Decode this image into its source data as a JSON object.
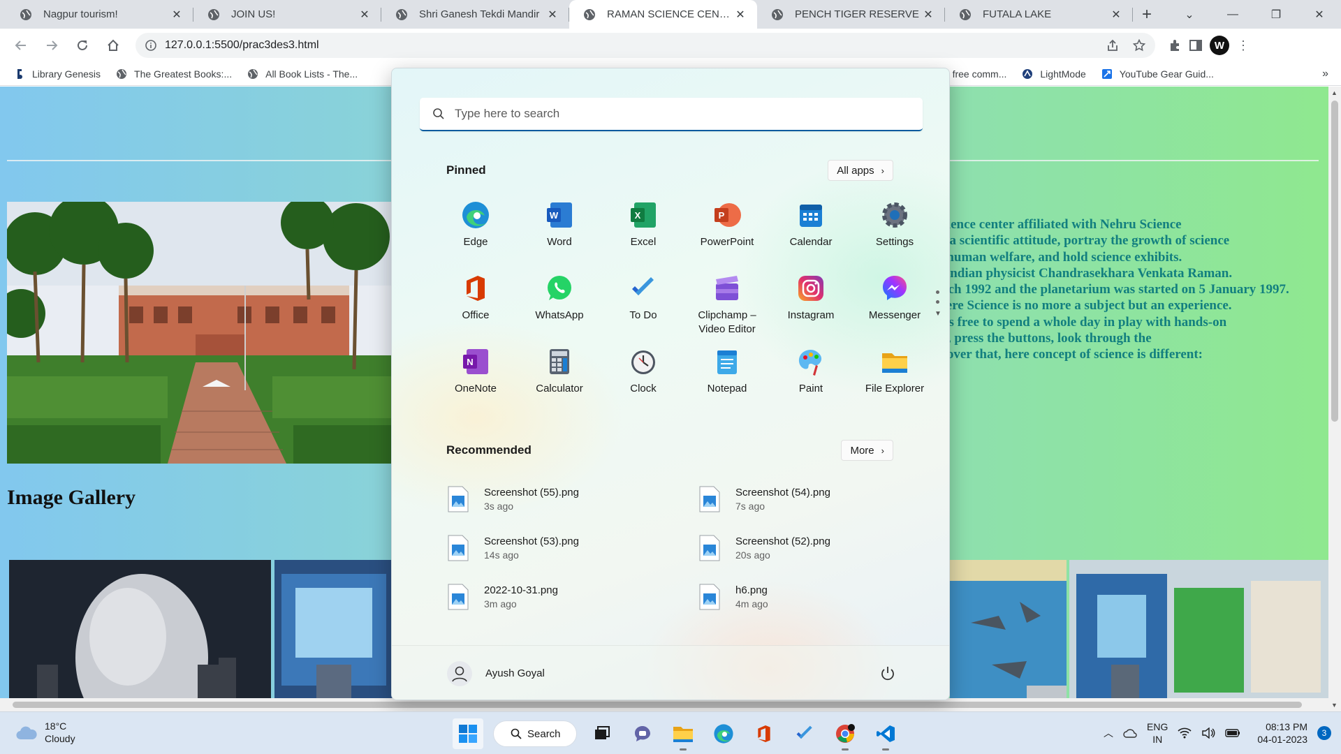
{
  "browser": {
    "tabs": [
      {
        "title": "Nagpur tourism!",
        "active": false
      },
      {
        "title": "JOIN US!",
        "active": false
      },
      {
        "title": "Shri Ganesh Tekdi Mandir",
        "active": false
      },
      {
        "title": "RAMAN SCIENCE CENTER",
        "active": true
      },
      {
        "title": "PENCH TIGER RESERVE",
        "active": false
      },
      {
        "title": "FUTALA LAKE",
        "active": false
      }
    ],
    "url": "127.0.0.1:5500/prac3des3.html",
    "bookmarks": [
      {
        "label": "Library Genesis",
        "icon": "library-icon"
      },
      {
        "label": "The Greatest Books:...",
        "icon": "globe-icon"
      },
      {
        "label": "All Book Lists - The...",
        "icon": "globe-icon"
      },
      {
        "label": "ng free comm...",
        "icon": "globe-icon"
      },
      {
        "label": "LightMode",
        "icon": "lightmode-icon"
      },
      {
        "label": "YouTube Gear Guid...",
        "icon": "kit-icon"
      }
    ],
    "bookmarks_more": "»"
  },
  "page": {
    "gallery_title": "Image Gallery",
    "text_lines": [
      "science center affiliated with Nehru Science",
      "te a scientific attitude, portray the growth of science",
      "d human welfare, and hold science exhibits.",
      "r Indian physicist Chandrasekhara Venkata Raman.",
      "arch 1992 and the planetarium was started on 5 January 1997.",
      "Here Science is no more a subject but an experience.",
      "e is free to spend a whole day in play with hands-on",
      "gs, press the buttons, look through the",
      "scover that, here concept of science is different:"
    ]
  },
  "start_menu": {
    "search_placeholder": "Type here to search",
    "pinned_label": "Pinned",
    "all_apps_label": "All apps",
    "pinned_apps": [
      {
        "label": "Edge",
        "icon": "edge-icon"
      },
      {
        "label": "Word",
        "icon": "word-icon"
      },
      {
        "label": "Excel",
        "icon": "excel-icon"
      },
      {
        "label": "PowerPoint",
        "icon": "powerpoint-icon"
      },
      {
        "label": "Calendar",
        "icon": "calendar-icon"
      },
      {
        "label": "Settings",
        "icon": "settings-icon"
      },
      {
        "label": "Office",
        "icon": "office-icon"
      },
      {
        "label": "WhatsApp",
        "icon": "whatsapp-icon"
      },
      {
        "label": "To Do",
        "icon": "todo-icon"
      },
      {
        "label": "Clipchamp – Video Editor",
        "icon": "clipchamp-icon"
      },
      {
        "label": "Instagram",
        "icon": "instagram-icon"
      },
      {
        "label": "Messenger",
        "icon": "messenger-icon"
      },
      {
        "label": "OneNote",
        "icon": "onenote-icon"
      },
      {
        "label": "Calculator",
        "icon": "calculator-icon"
      },
      {
        "label": "Clock",
        "icon": "clock-icon"
      },
      {
        "label": "Notepad",
        "icon": "notepad-icon"
      },
      {
        "label": "Paint",
        "icon": "paint-icon"
      },
      {
        "label": "File Explorer",
        "icon": "file-explorer-icon"
      }
    ],
    "recommended_label": "Recommended",
    "more_label": "More",
    "recommended": [
      {
        "name": "Screenshot (55).png",
        "time": "3s ago"
      },
      {
        "name": "Screenshot (54).png",
        "time": "7s ago"
      },
      {
        "name": "Screenshot (53).png",
        "time": "14s ago"
      },
      {
        "name": "Screenshot (52).png",
        "time": "20s ago"
      },
      {
        "name": "2022-10-31.png",
        "time": "3m ago"
      },
      {
        "name": "h6.png",
        "time": "4m ago"
      }
    ],
    "user_name": "Ayush Goyal"
  },
  "taskbar": {
    "weather_temp": "18°C",
    "weather_desc": "Cloudy",
    "search_label": "Search",
    "lang_top": "ENG",
    "lang_bottom": "IN",
    "time": "08:13 PM",
    "date": "04-01-2023",
    "notification_count": "3"
  },
  "colors": {
    "accent": "#0067c0",
    "page_gradient_left": "#82c8ee",
    "page_gradient_right": "#8fe88f",
    "page_text": "#127f7f"
  }
}
